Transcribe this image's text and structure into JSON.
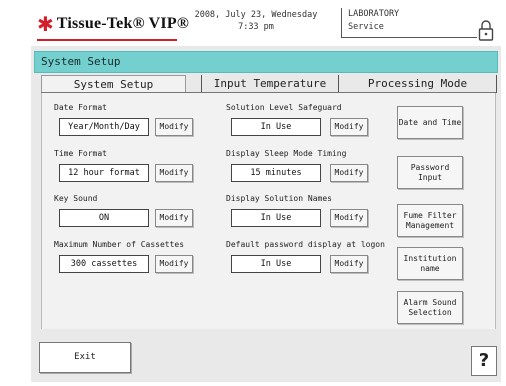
{
  "header": {
    "brand": "Tissue-Tek",
    "brand_suffix": "VIP",
    "date_line": "2008, July 23, Wednesday",
    "time_line": "7:33 pm",
    "location": "LABORATORY",
    "mode": "Service",
    "lock_icon": "lock-icon"
  },
  "title": "System Setup",
  "tabs": [
    {
      "label": "System Setup"
    },
    {
      "label": "Input Temperature"
    },
    {
      "label": "Processing Mode Selection"
    }
  ],
  "settings_left": [
    {
      "label": "Date Format",
      "value": "Year/Month/Day",
      "button": "Modify"
    },
    {
      "label": "Time Format",
      "value": "12 hour format",
      "button": "Modify"
    },
    {
      "label": "Key Sound",
      "value": "ON",
      "button": "Modify"
    },
    {
      "label": "Maximum Number of Cassettes",
      "value": "300 cassettes",
      "button": "Modify"
    }
  ],
  "settings_middle": [
    {
      "label": "Solution Level Safeguard",
      "value": "In Use",
      "button": "Modify"
    },
    {
      "label": "Display Sleep Mode Timing",
      "value": "15 minutes",
      "button": "Modify"
    },
    {
      "label": "Display Solution Names",
      "value": "In Use",
      "button": "Modify"
    },
    {
      "label": "Default password display at logon",
      "value": "In Use",
      "button": "Modify"
    }
  ],
  "side_buttons": [
    {
      "label": "Date and Time"
    },
    {
      "label": "Password Input"
    },
    {
      "label": "Fume Filter\nManagement"
    },
    {
      "label": "Institution name"
    },
    {
      "label": "Alarm Sound\nSelection"
    }
  ],
  "footer": {
    "exit_label": "Exit",
    "help_label": "?"
  },
  "colors": {
    "titlebar": "#74cfcf",
    "brand_red": "#d41e2a",
    "panel": "#f2f2f2"
  }
}
